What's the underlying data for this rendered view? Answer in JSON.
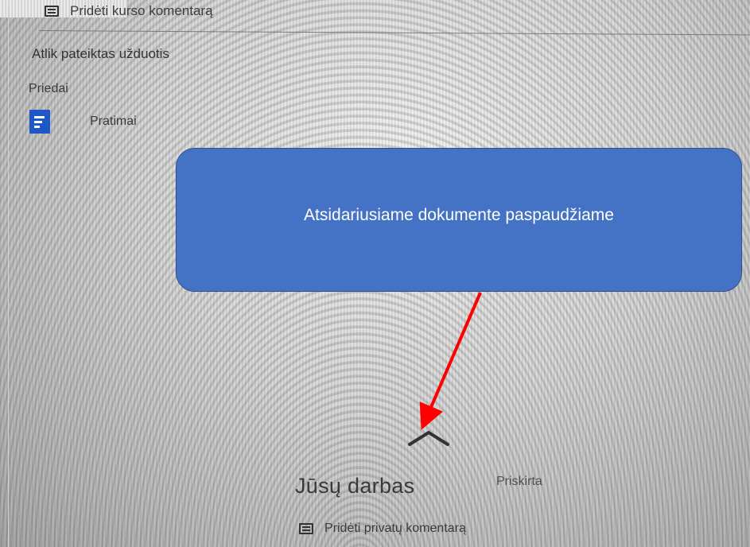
{
  "header": {
    "top_comment_label": "Pridėti kurso komentarą"
  },
  "assignment": {
    "instruction": "Atlik pateiktas užduotis",
    "attachments_label": "Priedai",
    "attachment_name": "Pratimai",
    "attachment_icon": "google-docs-icon"
  },
  "callout": {
    "text": "Atsidariusiame dokumente paspaudžiame",
    "color": "#4472c4"
  },
  "arrow": {
    "color": "#ff0000"
  },
  "your_work": {
    "title": "Jūsų darbas",
    "status": "Priskirta",
    "private_comment_label": "Pridėti privatų komentarą"
  }
}
